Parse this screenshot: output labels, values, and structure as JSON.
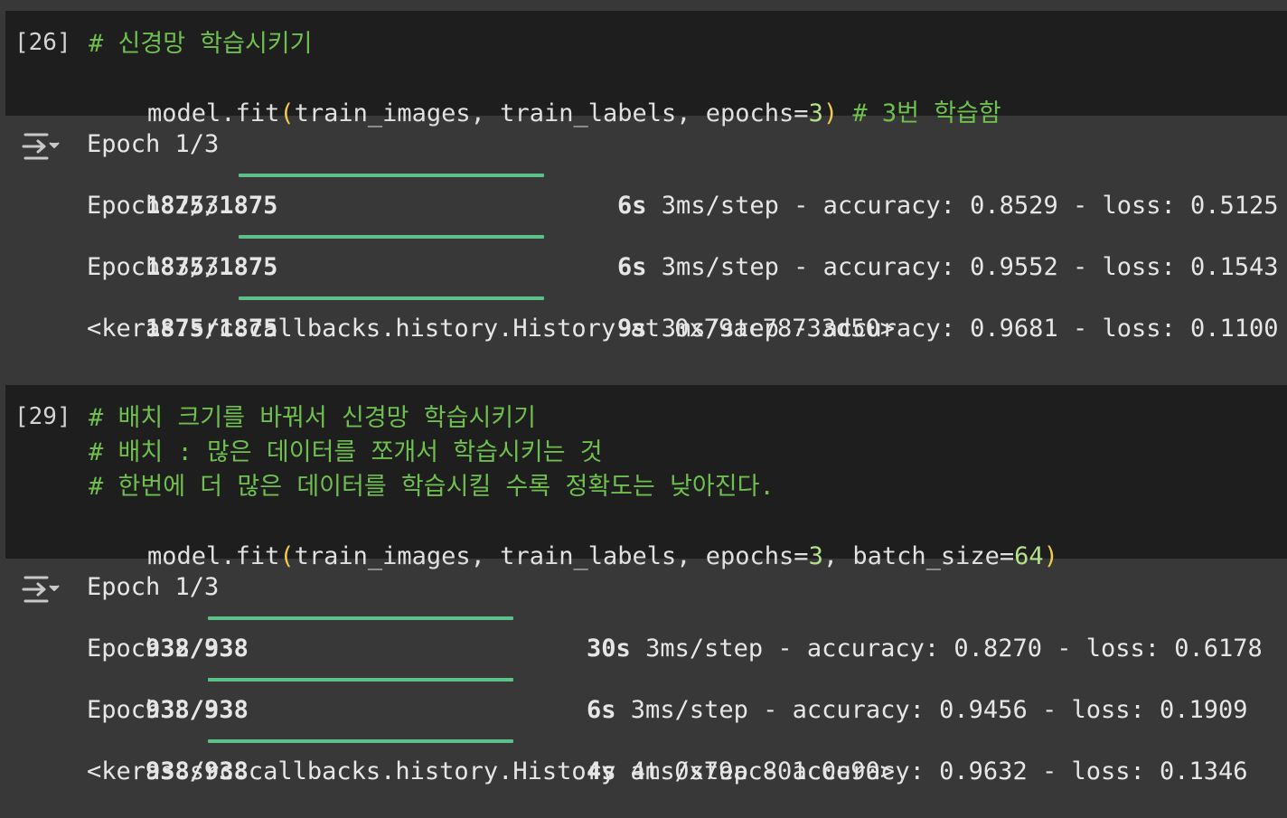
{
  "cells": [
    {
      "exec_count": "[26]",
      "code": {
        "line1_comment": "# 신경망 학습시키기",
        "line2": {
          "head": "model.fit",
          "open": "(",
          "args": "train_images, train_labels, epochs=",
          "num": "3",
          "close": ")",
          "comment": " # 3번 학습함"
        }
      },
      "output": {
        "icon": "output-toggle-icon",
        "epochs": [
          {
            "label": "Epoch 1/3",
            "step": "1875/1875",
            "progress": 1.0,
            "time": "6s",
            "rest": " 3ms/step - accuracy: 0.8529 - loss: 0.5125"
          },
          {
            "label": "Epoch 2/3",
            "step": "1875/1875",
            "progress": 1.0,
            "time": "6s",
            "rest": " 3ms/step - accuracy: 0.9552 - loss: 0.1543"
          },
          {
            "label": "Epoch 3/3",
            "step": "1875/1875",
            "progress": 1.0,
            "time": "9s",
            "rest": " 3ms/step - accuracy: 0.9681 - loss: 0.1100"
          }
        ],
        "result": "<keras.src.callbacks.history.History at 0x79ac78733d50>"
      }
    },
    {
      "exec_count": "[29]",
      "code": {
        "line1_comment": "# 배치 크기를 바꿔서 신경망 학습시키기",
        "line2_comment": "# 배치 : 많은 데이터를 쪼개서 학습시키는 것",
        "line3_comment": "# 한번에 더 많은 데이터를 학습시킬 수록 정확도는 낮아진다.",
        "line4": {
          "head": "model.fit",
          "open": "(",
          "args1": "train_images, train_labels, epochs=",
          "num1": "3",
          "args2": ", batch_size=",
          "num2": "64",
          "close": ")"
        }
      },
      "output": {
        "icon": "output-toggle-icon",
        "epochs": [
          {
            "label": "Epoch 1/3",
            "step": "938/938",
            "progress": 1.0,
            "time": "30s",
            "rest": " 3ms/step - accuracy: 0.8270 - loss: 0.6178"
          },
          {
            "label": "Epoch 2/3",
            "step": "938/938",
            "progress": 1.0,
            "time": "6s",
            "rest": " 3ms/step - accuracy: 0.9456 - loss: 0.1909"
          },
          {
            "label": "Epoch 3/3",
            "step": "938/938",
            "progress": 1.0,
            "time": "4s",
            "rest": " 4ms/step - accuracy: 0.9632 - loss: 0.1346"
          }
        ],
        "result": "<keras.src.callbacks.history.History at 0x79ac801c0e90>"
      }
    }
  ],
  "colors": {
    "input_bg": "#1e1e1e",
    "output_bg": "#383838",
    "comment": "#6fbf4f",
    "paren": "#f2c94c",
    "number": "#b5e08a",
    "progress_bar": "#5fbf8a"
  }
}
